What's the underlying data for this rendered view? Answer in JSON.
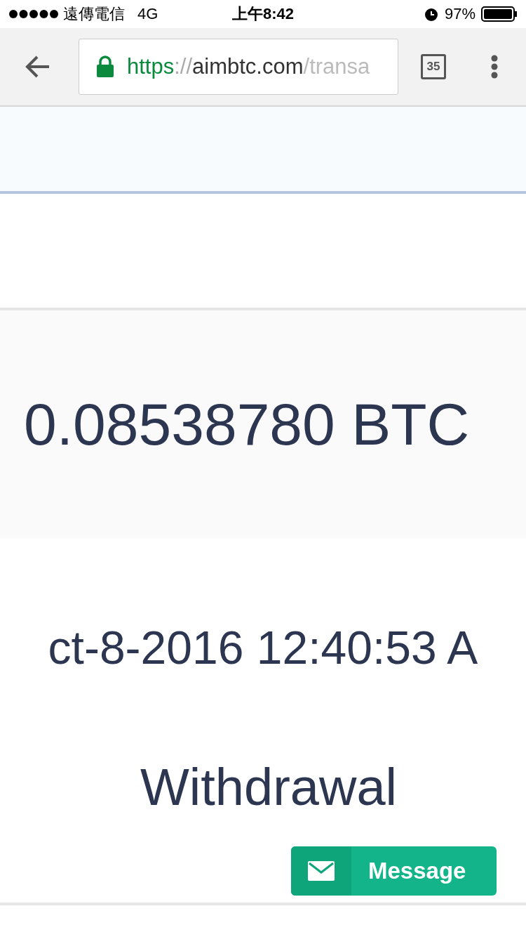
{
  "status_bar": {
    "carrier": "遠傳電信",
    "network": "4G",
    "time": "上午8:42",
    "battery": "97%"
  },
  "browser": {
    "url": {
      "scheme": "https",
      "separator": "://",
      "host": "aimbtc.com",
      "path": "/transa"
    },
    "tab_count": "35"
  },
  "transaction": {
    "amount": "0.08538780 BTC",
    "date": "ct-8-2016 12:40:53 A",
    "type": "Withdrawal",
    "message_button": "Message"
  }
}
